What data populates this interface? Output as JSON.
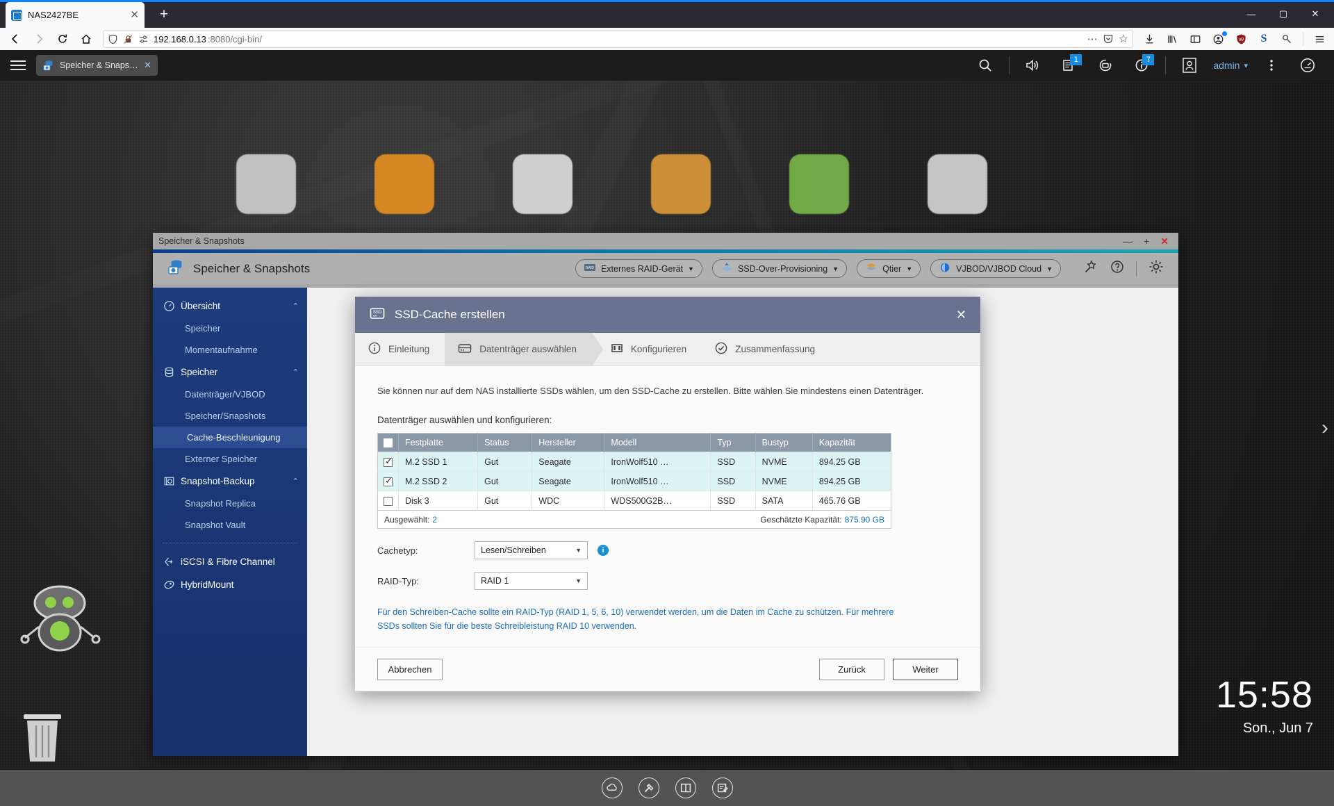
{
  "browser": {
    "tab": {
      "title": "NAS2427BE",
      "favicon": "qnap-favicon",
      "close": "✕"
    },
    "newtab_label": "+",
    "window_buttons": {
      "minimize": "—",
      "maximize": "▢",
      "close": "✕"
    },
    "nav": {
      "back": "←",
      "forward": "→",
      "reload": "⟳",
      "home": "⌂"
    },
    "url": {
      "host": "192.168.0.13",
      "port_path": ":8080/cgi-bin/",
      "more": "⋯",
      "pocket": "pocket-icon",
      "bookmark": "☆"
    },
    "toolbar_icons": [
      "downloads-icon",
      "library-icon",
      "sidebar-icon",
      "account-icon",
      "ublock-origin-icon",
      "s-extension-icon",
      "key-icon",
      "app-menu-icon"
    ]
  },
  "qnap_topbar": {
    "menu": "hamburger-menu",
    "app_tab": {
      "label": "Speicher & Snapsh…",
      "close": "✕"
    },
    "user": "admin",
    "user_caret": "▾",
    "badges": {
      "notes": "1",
      "info": "7"
    },
    "icons": [
      "search-icon",
      "volume-icon",
      "notes-icon",
      "backup-icon",
      "info-icon",
      "user-avatar-icon",
      "more-vert-icon",
      "dashboard-icon"
    ]
  },
  "window": {
    "titlebar": {
      "title": "Speicher & Snapshots",
      "minimize": "—",
      "maximize": "+",
      "close": "✕"
    },
    "header": {
      "title": "Speicher & Snapshots",
      "pills": [
        {
          "label": "Externes RAID-Gerät",
          "icon": "raid-device-icon",
          "caret": "▼"
        },
        {
          "label": "SSD-Over-Provisioning",
          "icon": "ssd-overprov-icon",
          "caret": "▼"
        },
        {
          "label": "Qtier",
          "icon": "qtier-icon",
          "caret": "▼"
        },
        {
          "label": "VJBOD/VJBOD Cloud",
          "icon": "vjbod-icon",
          "caret": "▼"
        }
      ],
      "icons": [
        "wand-icon",
        "help-icon",
        "settings-gear-icon"
      ]
    }
  },
  "sidebar": {
    "groups": [
      {
        "label": "Übersicht",
        "icon": "gauge-icon",
        "chevron": "⌃",
        "items": [
          {
            "label": "Speicher",
            "active": false
          },
          {
            "label": "Momentaufnahme",
            "active": false
          }
        ]
      },
      {
        "label": "Speicher",
        "icon": "database-icon",
        "chevron": "⌃",
        "items": [
          {
            "label": "Datenträger/VJBOD",
            "active": false
          },
          {
            "label": "Speicher/Snapshots",
            "active": false
          },
          {
            "label": "Cache-Beschleunigung",
            "active": true
          },
          {
            "label": "Externer Speicher",
            "active": false
          }
        ]
      },
      {
        "label": "Snapshot-Backup",
        "icon": "snapshot-icon",
        "chevron": "⌃",
        "items": [
          {
            "label": "Snapshot Replica",
            "active": false
          },
          {
            "label": "Snapshot Vault",
            "active": false
          }
        ]
      }
    ],
    "footer_items": [
      {
        "label": "iSCSI & Fibre Channel",
        "icon": "iscsi-icon"
      },
      {
        "label": "HybridMount",
        "icon": "hybridmount-icon"
      }
    ]
  },
  "dialog": {
    "title": "SSD-Cache erstellen",
    "icon": "ssd-icon",
    "close": "✕",
    "steps": [
      {
        "label": "Einleitung",
        "icon": "info-circle-icon",
        "active": false
      },
      {
        "label": "Datenträger auswählen",
        "icon": "disk-icon",
        "active": true
      },
      {
        "label": "Konfigurieren",
        "icon": "configure-icon",
        "active": false
      },
      {
        "label": "Zusammenfassung",
        "icon": "check-circle-icon",
        "active": false
      }
    ],
    "intro": "Sie können nur auf dem NAS installierte SSDs wählen, um den SSD-Cache zu erstellen. Bitte wählen Sie mindestens einen Datenträger.",
    "sublabel": "Datenträger auswählen und konfigurieren:",
    "table": {
      "columns": [
        "",
        "Festplatte",
        "Status",
        "Hersteller",
        "Modell",
        "Typ",
        "Bustyp",
        "Kapazität"
      ],
      "rows": [
        {
          "checked": true,
          "cells": [
            "M.2 SSD 1",
            "Gut",
            "Seagate",
            "IronWolf510 …",
            "SSD",
            "NVME",
            "894.25 GB"
          ]
        },
        {
          "checked": true,
          "cells": [
            "M.2 SSD 2",
            "Gut",
            "Seagate",
            "IronWolf510 …",
            "SSD",
            "NVME",
            "894.25 GB"
          ]
        },
        {
          "checked": false,
          "cells": [
            "Disk 3",
            "Gut",
            "WDC",
            "WDS500G2B…",
            "SSD",
            "SATA",
            "465.76 GB"
          ]
        }
      ],
      "footer_left_label": "Ausgewählt:",
      "footer_left_value": "2",
      "footer_right_label": "Geschätzte Kapazität:",
      "footer_right_value": "875.90 GB"
    },
    "fields": [
      {
        "label": "Cachetyp:",
        "value": "Lesen/Schreiben",
        "caret": "▼",
        "has_info": true,
        "info_glyph": "i"
      },
      {
        "label": "RAID-Typ:",
        "value": "RAID 1",
        "caret": "▼",
        "has_info": false
      }
    ],
    "warning": "Für den Schreiben-Cache sollte ein RAID-Typ (RAID 1, 5, 6, 10) verwendet werden, um die Daten im Cache zu schützen. Für mehrere SSDs sollten Sie für die beste Schreibleistung RAID 10 verwenden.",
    "buttons": {
      "cancel": "Abbrechen",
      "back": "Zurück",
      "next": "Weiter"
    }
  },
  "desktop": {
    "clock_time": "15:58",
    "clock_date": "Son., Jun 7",
    "page_dots": 3,
    "active_dot": 0,
    "taskbar_icons": [
      "cloud-icon",
      "hammer-icon",
      "book-icon",
      "notes-edit-icon"
    ],
    "robot": "helper-robot-icon",
    "trash": "trash-icon",
    "arrow_right": "›"
  },
  "colors": {
    "accent_blue": "#1773c4",
    "sidebar_blue": "#1d3c7d",
    "dialog_header": "#6b7290",
    "table_header": "#8b98a8",
    "row_selected": "#ddf4f4",
    "badge_blue": "#1a8ce0"
  }
}
